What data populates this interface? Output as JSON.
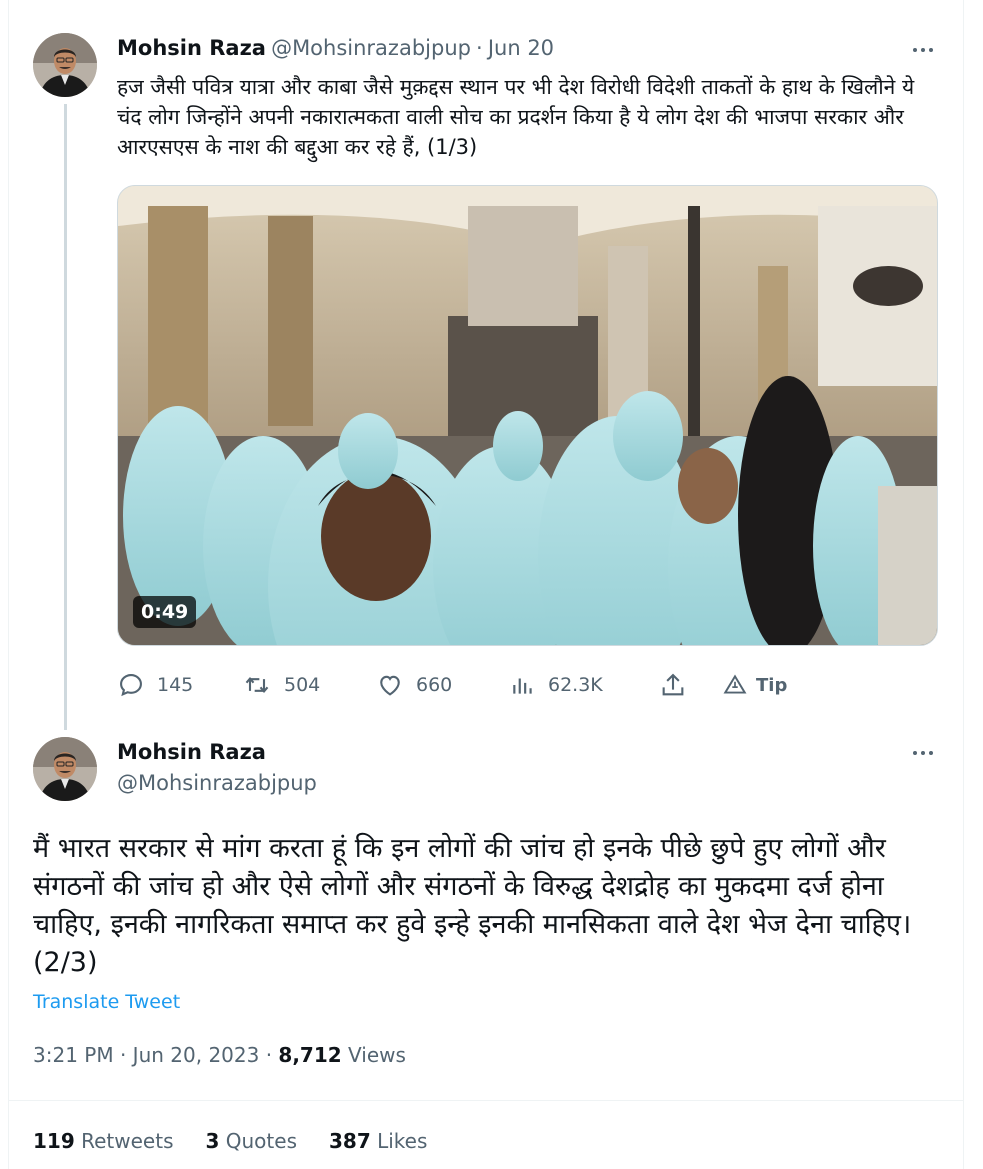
{
  "tweet1": {
    "name": "Mohsin Raza",
    "handle": "@Mohsinrazabjpup",
    "separator": "·",
    "date": "Jun 20",
    "text": "हज जैसी पवित्र यात्रा और काबा जैसे मुक़द्दस स्थान पर भी देश विरोधी विदेशी ताकतों के हाथ के खिलौने ये चंद लोग जिन्होंने अपनी नकारात्मकता वाली सोच का प्रदर्शन किया है ये लोग देश की भाजपा सरकार और आरएसएस के नाश की बद्दुआ कर रहे हैं, (1/3)",
    "video_duration": "0:49",
    "actions": {
      "replies": "145",
      "retweets": "504",
      "likes": "660",
      "views": "62.3K",
      "tip_label": "Tip"
    }
  },
  "tweet2": {
    "name": "Mohsin Raza",
    "handle": "@Mohsinrazabjpup",
    "text": "मैं भारत सरकार से मांग करता हूं कि इन लोगों की जांच हो इनके पीछे छुपे हुए लोगों और संगठनों की जांच हो और ऐसे लोगों और संगठनों के विरुद्ध देशद्रोह का मुकदमा दर्ज होना चाहिए, इनकी नागरिकता समाप्त कर हुवे इन्हे इनकी मानसिकता वाले देश भेज देना चाहिए।(2/3)",
    "translate_label": "Translate Tweet",
    "time": "3:21 PM",
    "sep1": "·",
    "date": "Jun 20, 2023",
    "sep2": "·",
    "views_count": "8,712",
    "views_label": "Views",
    "stats": {
      "retweets_count": "119",
      "retweets_label": "Retweets",
      "quotes_count": "3",
      "quotes_label": "Quotes",
      "likes_count": "387",
      "likes_label": "Likes"
    }
  },
  "colors": {
    "text_primary": "#0f1419",
    "text_secondary": "#536471",
    "link": "#1d9bf0",
    "border": "#cfd9de"
  },
  "icons": [
    "more-icon",
    "reply-icon",
    "retweet-icon",
    "like-icon",
    "views-icon",
    "share-icon",
    "tip-icon"
  ]
}
